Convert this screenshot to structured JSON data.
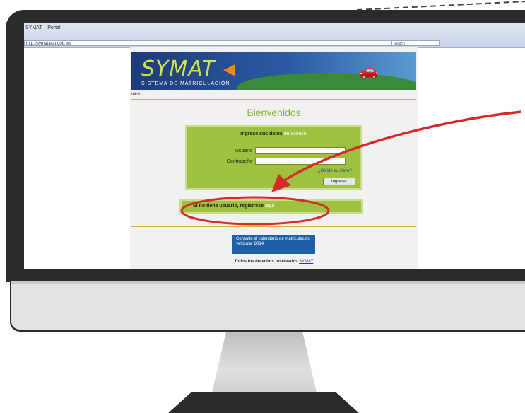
{
  "browser": {
    "tab_title": "SYMAT – Portal",
    "address": "http://symat.esp.gob.ec/",
    "search_placeholder": "Search"
  },
  "banner": {
    "logo": "SYMAT",
    "tagline": "SISTEMA DE MATRICULACIÓN"
  },
  "nav": {
    "home_link": "Inicio"
  },
  "login": {
    "welcome": "Bienvenidos",
    "title_prefix": "Ingrese sus datos",
    "title_highlight": "de acceso",
    "user_label": "Usuario",
    "password_label": "Contraseña",
    "forgot_link": "¿Olvidó su clave?",
    "submit_label": "Ingresar"
  },
  "notice": {
    "text": "Si no tiene usuario, regístrese",
    "link": "aquí"
  },
  "promo": {
    "text": "Consulte el calendario de matriculación vehicular 2014"
  },
  "footer": {
    "text_prefix": "Todos los derechos reservados",
    "link": "SYMAT"
  },
  "colors": {
    "form_green": "#9ec13f",
    "accent_orange": "#e8a456",
    "annotation_red": "#d42a2a",
    "bezel": "#2b2b2b"
  }
}
